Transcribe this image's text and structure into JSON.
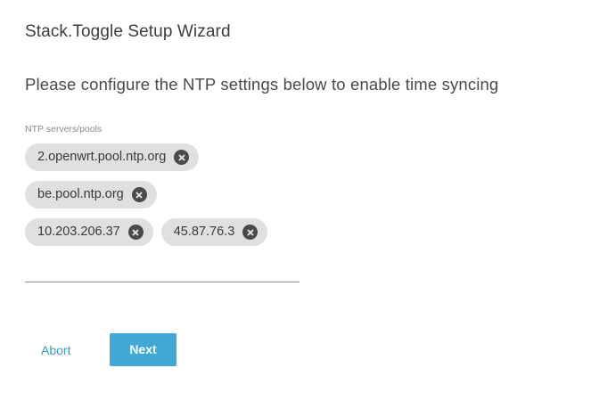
{
  "wizard": {
    "title": "Stack.Toggle Setup Wizard",
    "instructions": "Please configure the NTP settings below to enable time syncing"
  },
  "ntp_field": {
    "label": "NTP servers/pools",
    "chips": [
      {
        "label": "2.openwrt.pool.ntp.org",
        "delete_icon": "cancel-circle-icon"
      },
      {
        "label": "be.pool.ntp.org",
        "delete_icon": "cancel-circle-icon"
      },
      {
        "label": "10.203.206.37",
        "delete_icon": "cancel-circle-icon"
      },
      {
        "label": "45.87.76.3",
        "delete_icon": "cancel-circle-icon"
      }
    ],
    "input_value": ""
  },
  "actions": {
    "abort_label": "Abort",
    "next_label": "Next"
  },
  "colors": {
    "accent": "#42a9d6",
    "link": "#3a9cc9",
    "chip_background": "#e0e0e0"
  }
}
